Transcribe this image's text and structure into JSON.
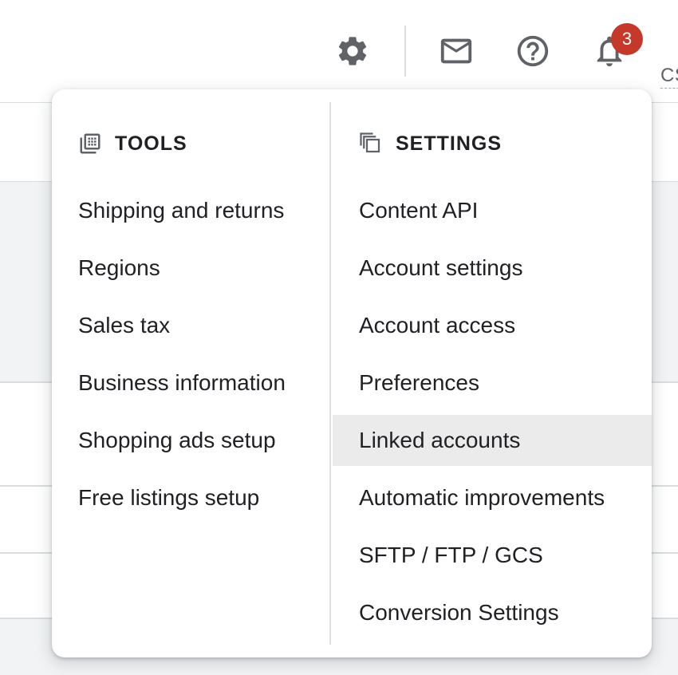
{
  "topbar": {
    "settings_icon": "gear-icon",
    "mail_icon": "mail-icon",
    "help_icon": "help-icon",
    "notifications_icon": "bell-icon",
    "notification_count": "3",
    "account_initials": "CS"
  },
  "menu": {
    "tools": {
      "icon": "tools-grid-icon",
      "title": "TOOLS",
      "items": [
        {
          "label": "Shipping and returns"
        },
        {
          "label": "Regions"
        },
        {
          "label": "Sales tax"
        },
        {
          "label": "Business information"
        },
        {
          "label": "Shopping ads setup"
        },
        {
          "label": "Free listings setup"
        }
      ]
    },
    "settings": {
      "icon": "settings-stack-icon",
      "title": "SETTINGS",
      "highlighted_item": "Linked accounts",
      "items": [
        {
          "label": "Content API"
        },
        {
          "label": "Account settings"
        },
        {
          "label": "Account access"
        },
        {
          "label": "Preferences"
        },
        {
          "label": "Linked accounts"
        },
        {
          "label": "Automatic improvements"
        },
        {
          "label": "SFTP / FTP / GCS"
        },
        {
          "label": "Conversion Settings"
        }
      ]
    }
  },
  "colors": {
    "badge": "#c5392a",
    "highlight": "#ebebeb",
    "icon": "#5f6368",
    "text": "#202124"
  }
}
